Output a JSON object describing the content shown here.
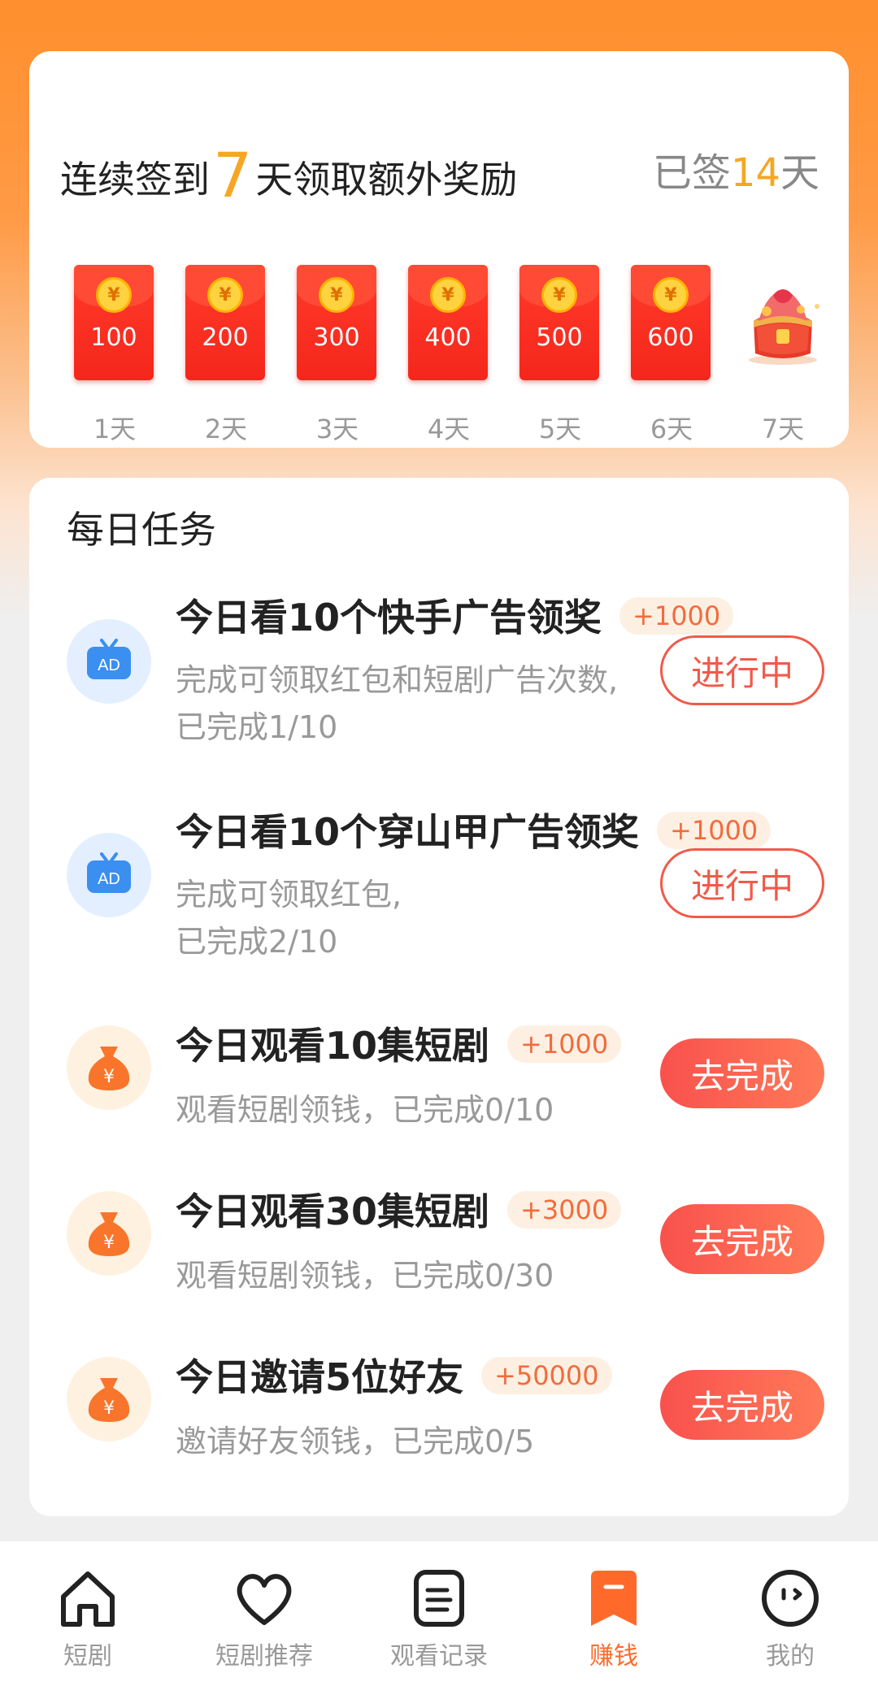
{
  "checkin": {
    "title_prefix": "连续签到",
    "title_days": "7",
    "title_suffix": "天领取额外奖励",
    "signed_prefix": "已签",
    "signed_days": "14",
    "signed_suffix": "天",
    "days": [
      {
        "label": "1天",
        "value": "100",
        "coin": "¥"
      },
      {
        "label": "2天",
        "value": "200",
        "coin": "¥"
      },
      {
        "label": "3天",
        "value": "300",
        "coin": "¥"
      },
      {
        "label": "4天",
        "value": "400",
        "coin": "¥"
      },
      {
        "label": "5天",
        "value": "500",
        "coin": "¥"
      },
      {
        "label": "6天",
        "value": "600",
        "coin": "¥"
      },
      {
        "label": "7天",
        "value": "",
        "coin": ""
      }
    ]
  },
  "tasks": {
    "title": "每日任务",
    "items": [
      {
        "title": "今日看10个快手广告领奖",
        "reward": "+1000",
        "desc1": "完成可领取红包和短剧广告次数,",
        "desc2": "已完成1/10",
        "button": "进行中",
        "icon": "ad-tv-icon"
      },
      {
        "title": "今日看10个穿山甲广告领奖",
        "reward": "+1000",
        "desc1": "完成可领取红包,",
        "desc2": "已完成2/10",
        "button": "进行中",
        "icon": "ad-tv-icon"
      },
      {
        "title": "今日观看10集短剧",
        "reward": "+1000",
        "desc1": "观看短剧领钱，已完成0/10",
        "desc2": "",
        "button": "去完成",
        "icon": "money-bag-icon"
      },
      {
        "title": "今日观看30集短剧",
        "reward": "+3000",
        "desc1": "观看短剧领钱，已完成0/30",
        "desc2": "",
        "button": "去完成",
        "icon": "money-bag-icon"
      },
      {
        "title": "今日邀请5位好友",
        "reward": "+50000",
        "desc1": "邀请好友领钱，已完成0/5",
        "desc2": "",
        "button": "去完成",
        "icon": "money-bag-icon"
      }
    ]
  },
  "nav": [
    {
      "label": "短剧",
      "icon": "home-icon"
    },
    {
      "label": "短剧推荐",
      "icon": "heart-icon"
    },
    {
      "label": "观看记录",
      "icon": "list-icon"
    },
    {
      "label": "赚钱",
      "icon": "bookmark-icon",
      "active": true
    },
    {
      "label": "我的",
      "icon": "face-icon"
    }
  ],
  "colors": {
    "accent": "#ff6a2b",
    "gold": "#f6a623",
    "red": "#f15a4a"
  },
  "ad_badge": "AD",
  "bag_symbol": "¥"
}
